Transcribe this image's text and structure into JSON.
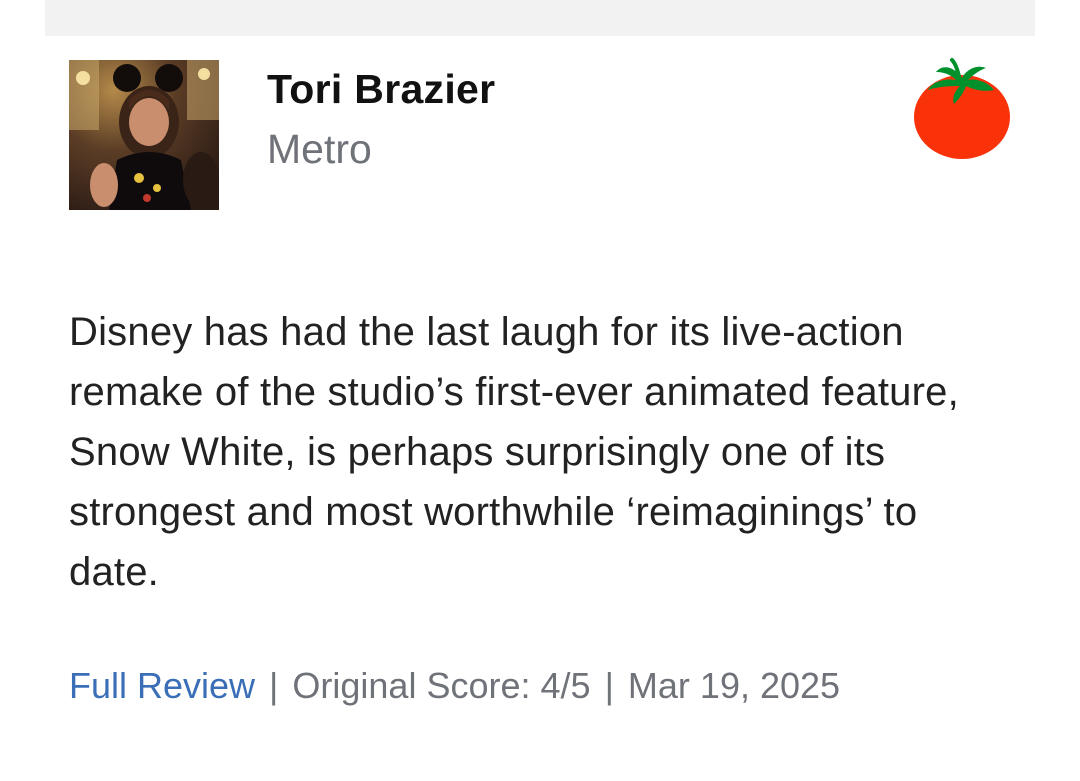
{
  "review": {
    "critic_name": "Tori Brazier",
    "publication": "Metro",
    "score_icon": "fresh-tomato-icon",
    "quote": "Disney has had the last laugh for its live-action remake of the studio’s first-ever animated feature, Snow White, is perhaps surprisingly one of its strongest and most worthwhile ‘reimaginings’ to date.",
    "footer": {
      "full_review_label": "Full Review",
      "separator": "|",
      "original_score": "Original Score: 4/5",
      "date": "Mar 19, 2025"
    }
  },
  "colors": {
    "link": "#3a6fb7",
    "muted_text": "#6f7278",
    "tomato_red": "#fa320a",
    "tomato_leaf": "#00912d"
  }
}
